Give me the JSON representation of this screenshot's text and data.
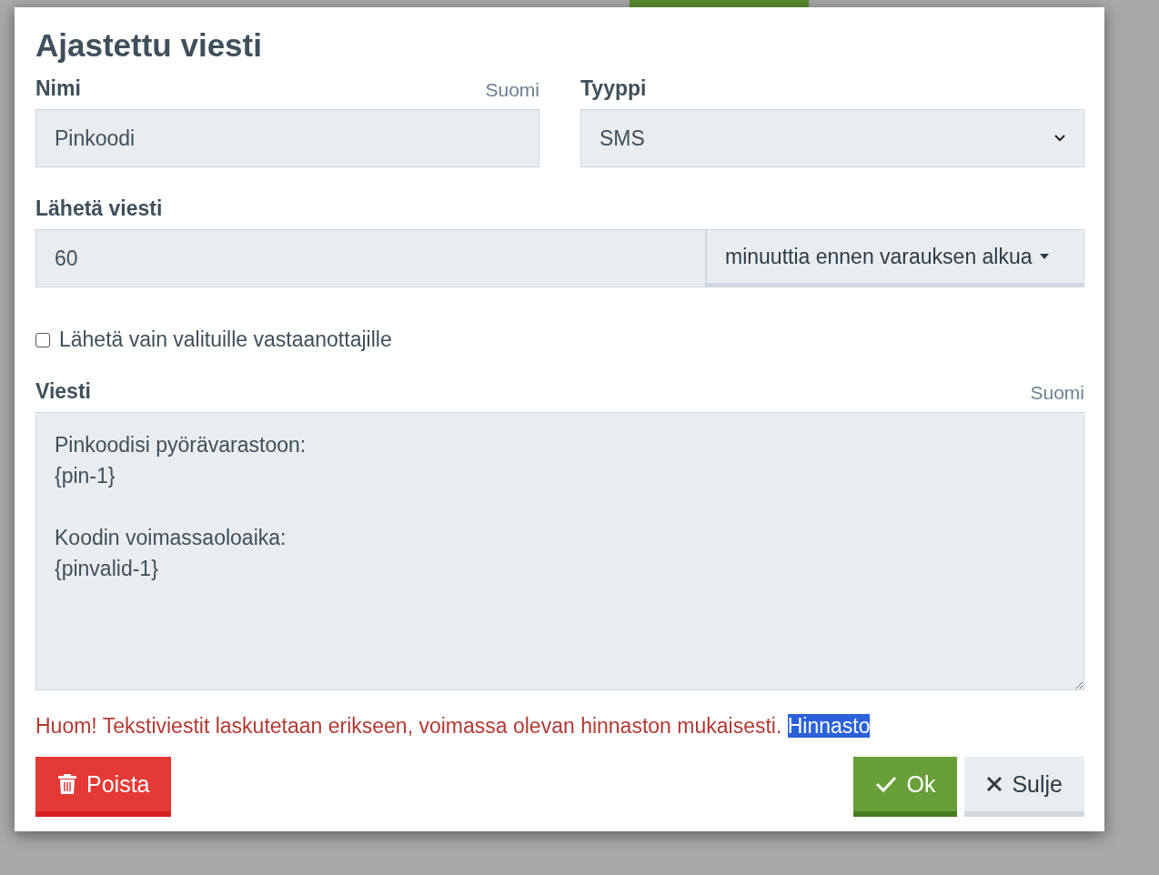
{
  "dialog": {
    "title": "Ajastettu viesti",
    "name_field": {
      "label": "Nimi",
      "language": "Suomi",
      "value": "Pinkoodi"
    },
    "type_field": {
      "label": "Tyyppi",
      "value": "SMS"
    },
    "send_field": {
      "label": "Lähetä viesti",
      "value": "60",
      "unit": "minuuttia ennen varauksen alkua"
    },
    "recipients_checkbox": {
      "label": "Lähetä vain valituille vastaanottajille",
      "checked": false
    },
    "message_field": {
      "label": "Viesti",
      "language": "Suomi",
      "value": "Pinkoodisi pyörävarastoon:\n{pin-1}\n\nKoodin voimassaoloaika:\n{pinvalid-1}"
    },
    "notice": "Huom! Tekstiviestit laskutetaan erikseen, voimassa olevan hinnaston mukaisesti.",
    "notice_link": {
      "label": "Hinnasto",
      "selected": true
    },
    "buttons": [
      {
        "kind": "delete",
        "label": "Poista"
      },
      {
        "kind": "ok",
        "label": "Ok"
      },
      {
        "kind": "close",
        "label": "Sulje"
      }
    ]
  }
}
